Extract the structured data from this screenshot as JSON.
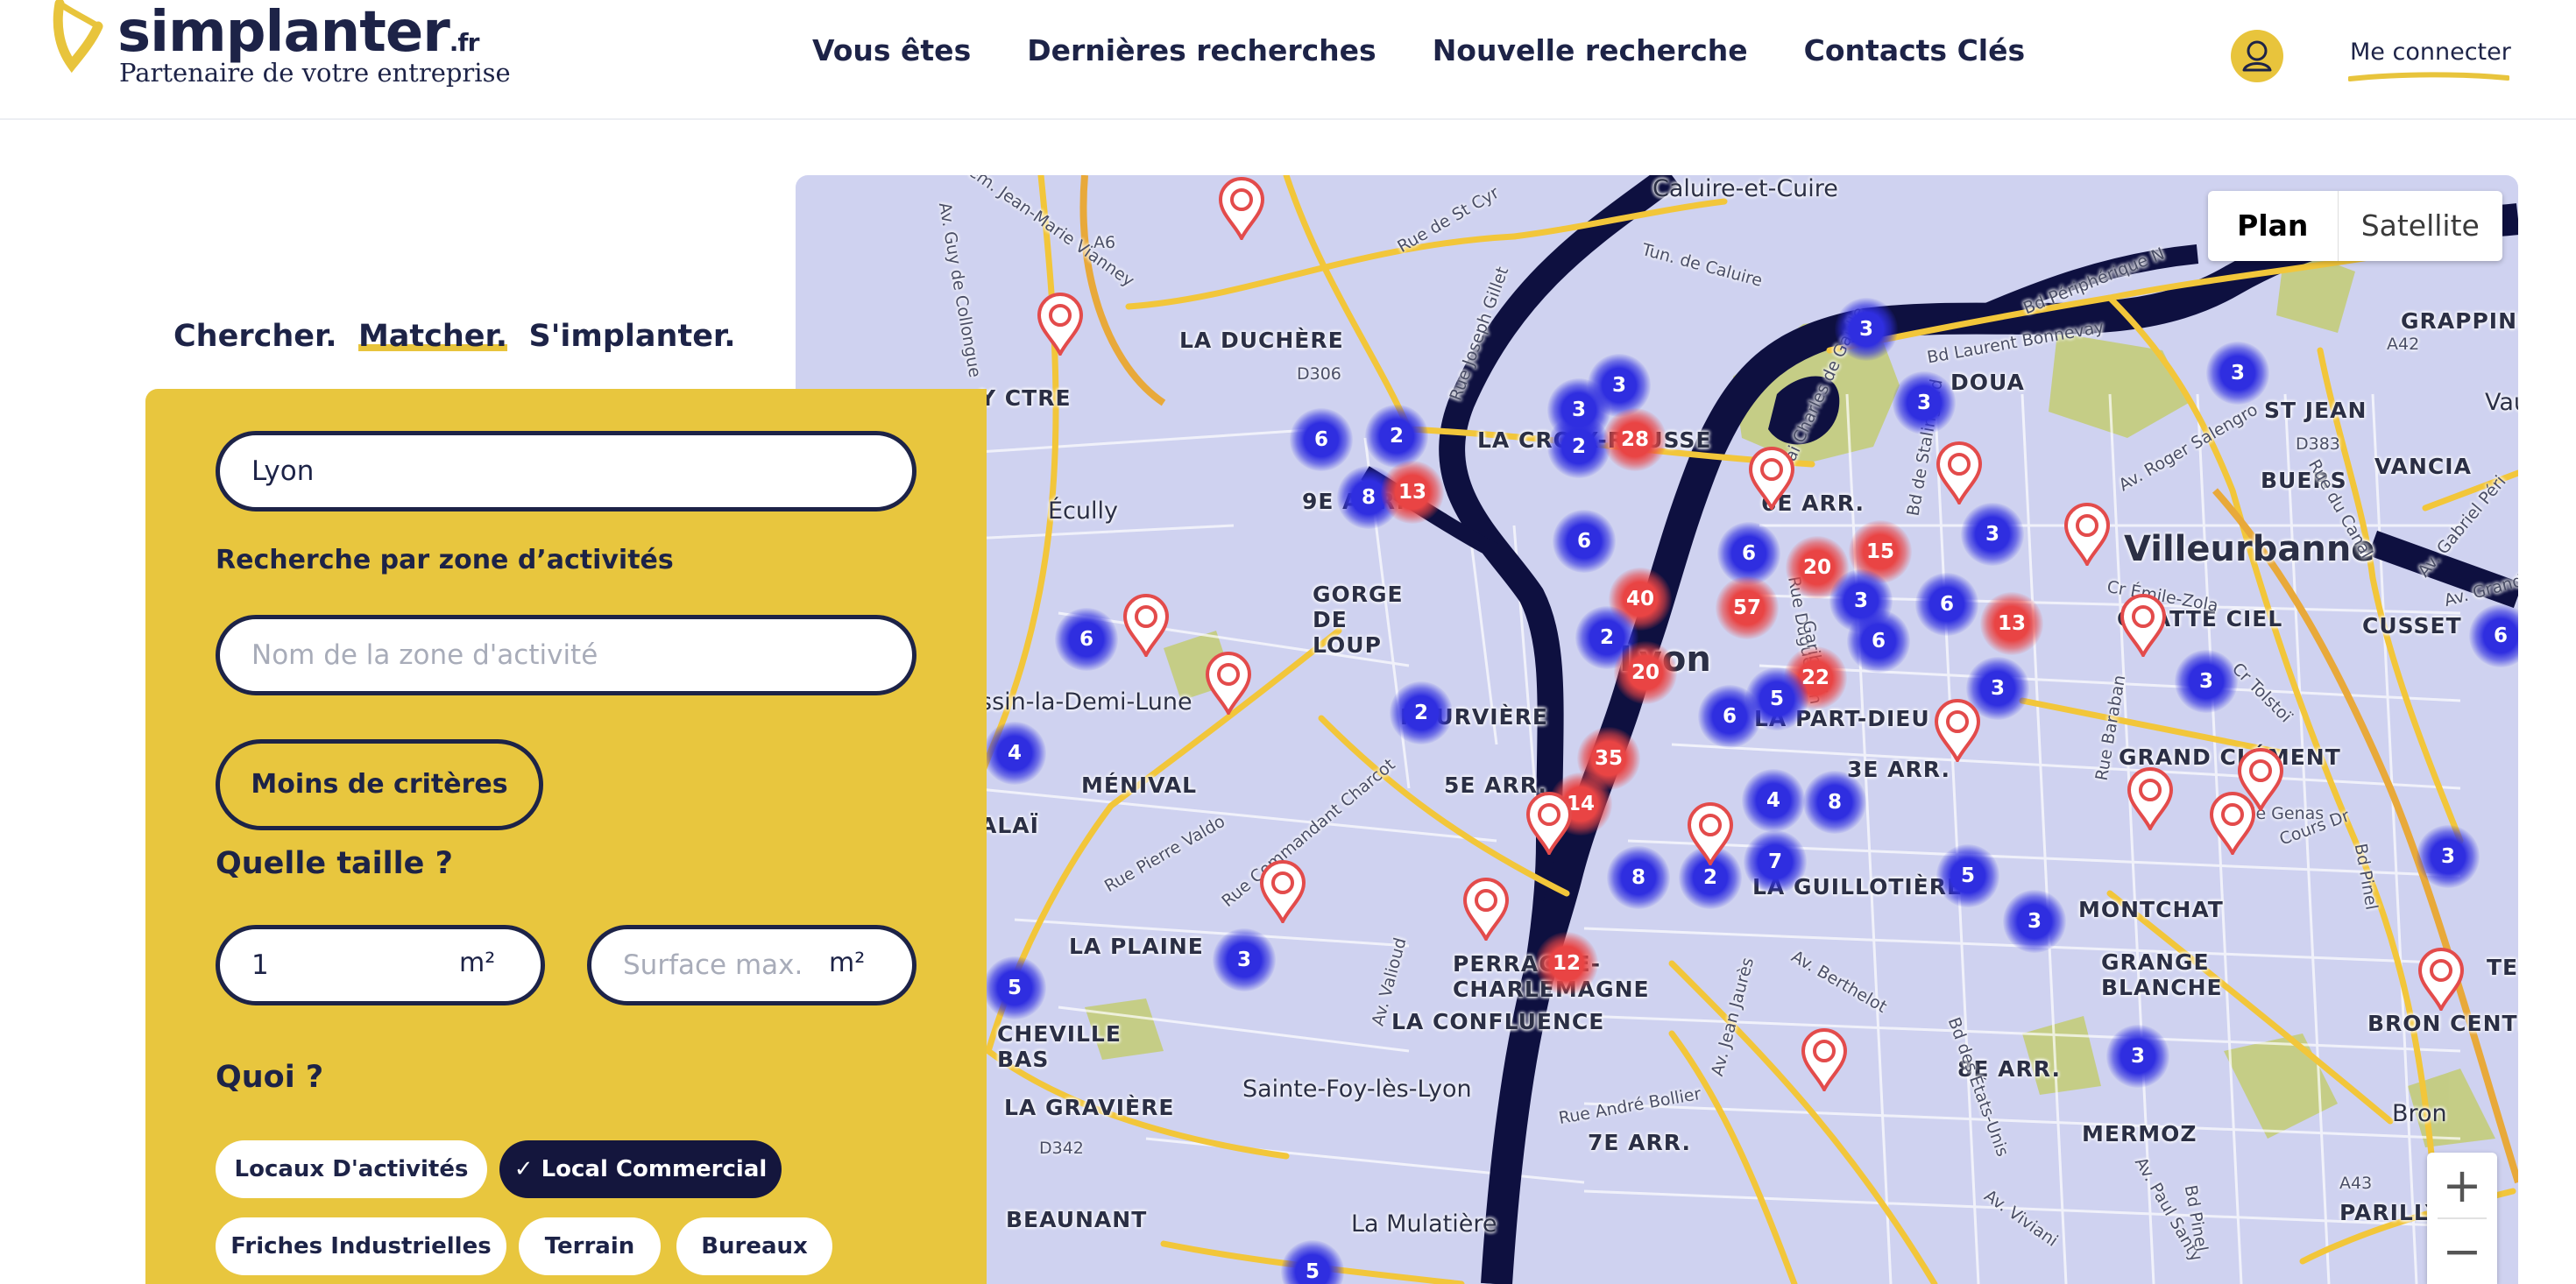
{
  "brand": {
    "name": "simplanter",
    "tld": ".fr",
    "tagline": "Partenaire de votre entreprise",
    "accent_color": "#e8c43c",
    "navy_color": "#1d2347"
  },
  "nav": {
    "items": [
      "Vous êtes",
      "Dernières recherches",
      "Nouvelle recherche",
      "Contacts Clés"
    ],
    "login_label": "Me connecter",
    "avatar_icon": "user-icon"
  },
  "search": {
    "slogan_parts": [
      "Chercher.",
      "Matcher.",
      "S'implanter."
    ],
    "location_value": "Lyon",
    "zone_label": "Recherche par zone d’activités",
    "zone_placeholder": "Nom de la zone d'activité",
    "toggle_criteria_label": "Moins de critères",
    "size_title": "Quelle taille ?",
    "surface_min_value": "1",
    "surface_max_placeholder": "Surface max.",
    "surface_unit": "m²",
    "what_title": "Quoi ?",
    "types": [
      {
        "label": "Locaux D'activités",
        "selected": false
      },
      {
        "label": "Local Commercial",
        "selected": true
      },
      {
        "label": "Friches Industrielles",
        "selected": false
      },
      {
        "label": "Terrain",
        "selected": false
      },
      {
        "label": "Bureaux",
        "selected": false
      }
    ],
    "check_icon": "check-icon"
  },
  "map": {
    "view_options": [
      "Plan",
      "Satellite"
    ],
    "selected_view": "Plan",
    "zoom_in": "+",
    "zoom_out": "−",
    "cluster_color_blue": "#2f2ee0",
    "cluster_color_red": "#e94444",
    "place_labels": [
      "Caluire-et-Cuire",
      "LA DUCHÈRE",
      "Écully",
      "LA CROIX-ROUSSE",
      "9E ARR.",
      "GORGE DE LOUP",
      "6E ARR.",
      "Villeurbanne",
      "GRATTE CIEL",
      "Lyon",
      "FOURVIÈRE",
      "LA PART-DIEU",
      "DOUA",
      "ST JEAN",
      "BUERS",
      "VANCIA",
      "CUSSET",
      "GRAPPINIÈRE",
      "Vaul",
      "ssin-la-Demi-Lune",
      "MÉNIVAL",
      "5E ARR.",
      "3E ARR.",
      "GRAND CLÉMENT",
      "LA PLAINE",
      "PERRACHE-CHARLEMAGNE",
      "LA CONFLUENCE",
      "LA GUILLOTIÈRE",
      "MONTCHAT",
      "GRANGE BLANCHE",
      "CHEVILLE BAS",
      "LA GRAVIÈRE",
      "Sainte-Foy-lès-Lyon",
      "7E ARR.",
      "8E ARR.",
      "MERMOZ",
      "BRON CENTR",
      "Bron",
      "BEAUNANT",
      "La Mulatière",
      "PARILLY",
      "Y CTRE",
      "ALAÏ",
      "TER"
    ],
    "road_labels": [
      "A6",
      "D306",
      "A42",
      "D383",
      "D342",
      "A43",
      "Rue de St Cyr",
      "Tun. de Caluire",
      "Bd Périphérique N",
      "Bd Laurent Bonnevay",
      "Quai Charles de Gaulle",
      "Av. Roger Salengro",
      "Rue du Canal",
      "Av. Gabriel Péri",
      "Av. Grandclé",
      "Bd de Stalingrad",
      "Rue Duguesclin",
      "Garibaldi",
      "Cr Émile-Zola",
      "Cr Tolstoï",
      "Rue Baraban",
      "Rte de Genas",
      "Cours Dr",
      "Bd Pinel",
      "Rue Pierre Valdo",
      "Rue Commandant Charcot",
      "Av. Valioud",
      "Av. Jean Jaurès",
      "Av. Berthelot",
      "Rue André Bollier",
      "Bd des États-Unis",
      "Av. Viviani",
      "Av. Paul Santy",
      "Bd Pinel",
      "Chem. Jean-Marie Vianney",
      "Av. Guy de Collongue",
      "Rue Joseph Gillet"
    ],
    "clusters": [
      {
        "count": "3",
        "color": "blue"
      },
      {
        "count": "3",
        "color": "blue"
      },
      {
        "count": "3",
        "color": "blue"
      },
      {
        "count": "3",
        "color": "blue"
      },
      {
        "count": "6",
        "color": "blue"
      },
      {
        "count": "2",
        "color": "blue"
      },
      {
        "count": "3",
        "color": "blue"
      },
      {
        "count": "2",
        "color": "blue"
      },
      {
        "count": "28",
        "color": "red"
      },
      {
        "count": "8",
        "color": "blue"
      },
      {
        "count": "13",
        "color": "red"
      },
      {
        "count": "6",
        "color": "blue"
      },
      {
        "count": "6",
        "color": "blue"
      },
      {
        "count": "20",
        "color": "red"
      },
      {
        "count": "15",
        "color": "red"
      },
      {
        "count": "3",
        "color": "blue"
      },
      {
        "count": "40",
        "color": "red"
      },
      {
        "count": "57",
        "color": "red"
      },
      {
        "count": "3",
        "color": "blue"
      },
      {
        "count": "6",
        "color": "blue"
      },
      {
        "count": "6",
        "color": "blue"
      },
      {
        "count": "13",
        "color": "red"
      },
      {
        "count": "6",
        "color": "blue"
      },
      {
        "count": "2",
        "color": "blue"
      },
      {
        "count": "20",
        "color": "red"
      },
      {
        "count": "22",
        "color": "red"
      },
      {
        "count": "5",
        "color": "blue"
      },
      {
        "count": "3",
        "color": "blue"
      },
      {
        "count": "3",
        "color": "blue"
      },
      {
        "count": "6",
        "color": "blue"
      },
      {
        "count": "2",
        "color": "blue"
      },
      {
        "count": "6",
        "color": "blue"
      },
      {
        "count": "4",
        "color": "blue"
      },
      {
        "count": "35",
        "color": "red"
      },
      {
        "count": "14",
        "color": "red"
      },
      {
        "count": "4",
        "color": "blue"
      },
      {
        "count": "8",
        "color": "blue"
      },
      {
        "count": "7",
        "color": "blue"
      },
      {
        "count": "8",
        "color": "blue"
      },
      {
        "count": "2",
        "color": "blue"
      },
      {
        "count": "5",
        "color": "blue"
      },
      {
        "count": "3",
        "color": "blue"
      },
      {
        "count": "3",
        "color": "blue"
      },
      {
        "count": "12",
        "color": "red"
      },
      {
        "count": "5",
        "color": "blue"
      },
      {
        "count": "3",
        "color": "blue"
      },
      {
        "count": "3",
        "color": "blue"
      },
      {
        "count": "5",
        "color": "blue"
      }
    ],
    "pin_icon": "map-pin-icon"
  }
}
